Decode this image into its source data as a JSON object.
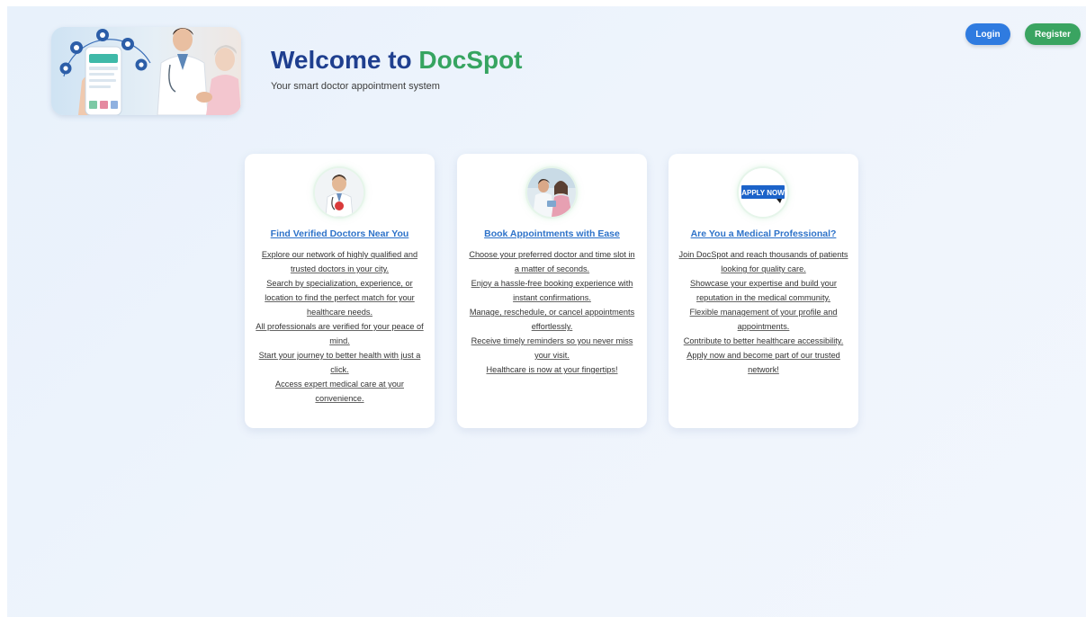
{
  "header": {
    "title_prefix": "Welcome to ",
    "title_brand": "DocSpot",
    "tagline": "Your smart doctor appointment system"
  },
  "auth": {
    "login_label": "Login",
    "register_label": "Register"
  },
  "colors": {
    "primary_blue": "#1f3f8f",
    "brand_green": "#36a460",
    "link_blue": "#2d72c9",
    "login_button": "#2f7be0",
    "register_button": "#3aa461"
  },
  "cards": [
    {
      "image_icon": "doctor-portrait-icon",
      "title": "Find Verified Doctors Near You",
      "lines": [
        "Explore our network of highly qualified and trusted doctors in your city.",
        "Search by specialization, experience, or location to find the perfect match for your healthcare needs.",
        "All professionals are verified for your peace of mind.",
        "Start your journey to better health with just a click.",
        "Access expert medical care at your convenience."
      ]
    },
    {
      "image_icon": "appointment-photo-icon",
      "title": "Book Appointments with Ease",
      "lines": [
        "Choose your preferred doctor and time slot in a matter of seconds.",
        "Enjoy a hassle-free booking experience with instant confirmations.",
        "Manage, reschedule, or cancel appointments effortlessly.",
        "Receive timely reminders so you never miss your visit.",
        "Healthcare is now at your fingertips!"
      ]
    },
    {
      "image_icon": "apply-now-badge",
      "badge_text": "APPLY NOW",
      "title": "Are You a Medical Professional?",
      "lines": [
        "Join DocSpot and reach thousands of patients looking for quality care.",
        "Showcase your expertise and build your reputation in the medical community.",
        "Flexible management of your profile and appointments.",
        "Contribute to better healthcare accessibility.",
        "Apply now and become part of our trusted network!"
      ]
    }
  ]
}
